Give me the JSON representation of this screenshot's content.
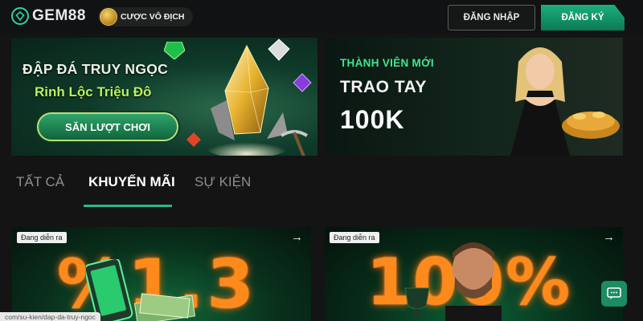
{
  "header": {
    "logo_text": "GEM88",
    "champion_label": "CƯỢC VÔ ĐỊCH",
    "login_label": "ĐĂNG NHẬP",
    "register_label": "ĐĂNG KÝ"
  },
  "banners": [
    {
      "title": "ĐẬP ĐÁ TRUY NGỌC",
      "subtitle": "Rinh Lộc Triệu Đô",
      "cta_label": "SĂN LƯỢT CHƠI"
    },
    {
      "kicker": "THÀNH VIÊN MỚI",
      "headline": "TRAO TAY",
      "amount": "100K"
    }
  ],
  "tabs": [
    {
      "label": "TẤT CẢ",
      "active": false
    },
    {
      "label": "KHUYẾN MÃI",
      "active": true
    },
    {
      "label": "SỰ KIỆN",
      "active": false
    }
  ],
  "cards": [
    {
      "badge": "Đang diễn ra",
      "arrow": "→",
      "big_text": "%1.3"
    },
    {
      "badge": "Đang diễn ra",
      "arrow": "→",
      "big_text": "100%"
    }
  ],
  "status_url": "com/su-kien/dap-da-truy-ngoc",
  "icons": {
    "logo": "gem-logo-icon",
    "champion": "medal-icon",
    "chat": "chat-icon",
    "arrow": "arrow-right-icon"
  },
  "colors": {
    "accent": "#1cae7c",
    "tab_underline": "#2bb884",
    "background": "#141414",
    "promo_orange": "#ff8a1c",
    "banner_green_text": "#b7f25a"
  }
}
